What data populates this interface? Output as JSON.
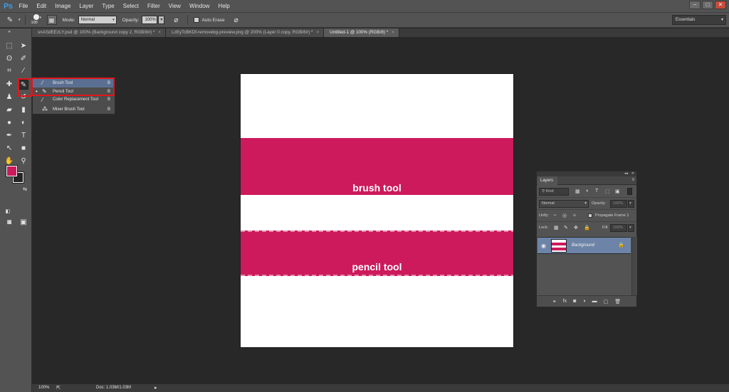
{
  "app": {
    "logo": "Ps"
  },
  "menu": [
    "File",
    "Edit",
    "Image",
    "Layer",
    "Type",
    "Select",
    "Filter",
    "View",
    "Window",
    "Help"
  ],
  "window_controls": {
    "minimize": "–",
    "restore": "□",
    "close": "✕"
  },
  "options_bar": {
    "brush_size": "100",
    "mode_label": "Mode:",
    "mode_value": "Normal",
    "opacity_label": "Opacity:",
    "opacity_value": "100%",
    "auto_erase_label": "Auto Erase",
    "auto_erase_checked": false
  },
  "workspace": {
    "value": "Essentials"
  },
  "tabs": [
    {
      "label": "snASdEEzLY.psd @ 100% (Background copy 2, RGB/8#) *",
      "close": "×"
    },
    {
      "label": "LzEyTcBKDf-removebg-preview.png @ 200% (Layer 0 copy, RGB/8#) *",
      "close": "×"
    },
    {
      "label": "Untitled-1 @ 100% (RGB/8) *",
      "close": "×"
    }
  ],
  "tool_flyout": [
    {
      "label": "Brush Tool",
      "shortcut": "B",
      "current": false
    },
    {
      "label": "Pencil Tool",
      "shortcut": "B",
      "current": true
    },
    {
      "label": "Color Replacement Tool",
      "shortcut": "B",
      "current": false
    },
    {
      "label": "Mixer Brush Tool",
      "shortcut": "B",
      "current": false
    }
  ],
  "colors": {
    "foreground": "#cc1a5c",
    "background": "#252525",
    "highlight_box": "#e0161b",
    "selected_layer": "#6d84a8"
  },
  "canvas": {
    "band1_label": "brush tool",
    "band2_label": "pencil tool",
    "band_color": "#cc1a5c"
  },
  "layers_panel": {
    "title": "Layers",
    "filter_kind": "Kind",
    "blend_mode": "Normal",
    "opacity_label": "Opacity:",
    "opacity_value": "100%",
    "unify_label": "Unify:",
    "propagate_label": "Propagate Frame 1",
    "lock_label": "Lock:",
    "fill_label": "Fill:",
    "fill_value": "100%",
    "layers": [
      {
        "name": "Background",
        "visible": true,
        "locked": true
      }
    ]
  },
  "status_bar": {
    "zoom": "100%",
    "doc_info": "Doc: 1.03M/1.03M"
  }
}
